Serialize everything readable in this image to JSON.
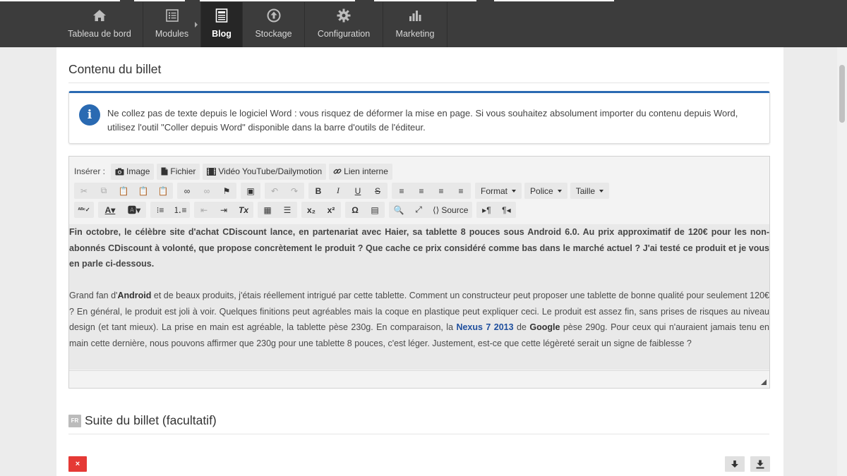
{
  "nav": {
    "items": [
      {
        "label": "Tableau de bord",
        "icon": "home-icon"
      },
      {
        "label": "Modules",
        "icon": "list-icon"
      },
      {
        "label": "Blog",
        "icon": "document-icon"
      },
      {
        "label": "Stockage",
        "icon": "upload-circle-icon"
      },
      {
        "label": "Configuration",
        "icon": "gear-icon"
      },
      {
        "label": "Marketing",
        "icon": "bar-chart-icon"
      }
    ],
    "active": "Blog"
  },
  "main": {
    "section_title": "Contenu du billet",
    "info": {
      "icon": "info-icon",
      "text": "Ne collez pas de texte depuis le logiciel Word : vous risquez de déformer la mise en page. Si vous souhaitez absolument importer du contenu depuis Word, utilisez l'outil \"Coller depuis Word\" disponible dans la barre d'outils de l'éditeur."
    },
    "editor": {
      "insert_label": "Insérer :",
      "insert_buttons": [
        {
          "label": "Image",
          "icon": "camera-icon"
        },
        {
          "label": "Fichier",
          "icon": "file-icon"
        },
        {
          "label": "Vidéo YouTube/Dailymotion",
          "icon": "film-icon"
        },
        {
          "label": "Lien interne",
          "icon": "link-icon"
        }
      ],
      "dropdowns": {
        "format": "Format",
        "police": "Police",
        "taille": "Taille"
      },
      "source_label": "Source",
      "content": {
        "intro": "Fin octobre, le célèbre site d'achat CDiscount lance, en partenariat avec Haier, sa tablette 8 pouces sous Android 6.0. Au prix approximatif de 120€ pour les non-abonnés CDiscount à volonté, que propose concrètement le produit ? Que cache ce prix considéré comme bas dans le marché actuel ? J'ai testé ce produit et je vous en parle ci-dessous.",
        "p2_a": "Grand fan d'",
        "p2_android": "Android",
        "p2_b": " et de beaux produits, j'étais réellement intrigué par cette tablette. Comment un constructeur peut proposer une tablette de bonne qualité pour seulement 120€ ? En général, le produit est joli à voir. Quelques finitions peut agréables mais la coque en plastique peut expliquer ceci. Le produit est assez fin, sans prises de risques au niveau design (et tant mieux). La prise en main est agréable, la tablette pèse 230g. En comparaison, la ",
        "p2_link": "Nexus 7 2013",
        "p2_c": " de ",
        "p2_google": "Google",
        "p2_d": " pèse 290g. Pour ceux qui n'auraient jamais tenu en main cette dernière, nous pouvons affirmer que 230g pour une tablette 8 pouces, c'est léger. Justement, est-ce que cette légèreté serait un signe de faiblesse ?"
      }
    },
    "sub_section": {
      "flag": "FR",
      "title": "Suite du billet (facultatif)"
    },
    "delete_label": "×",
    "colors": {
      "accent": "#2a6ab2",
      "danger": "#e53935",
      "nav_bg": "#3c3c3c"
    }
  }
}
